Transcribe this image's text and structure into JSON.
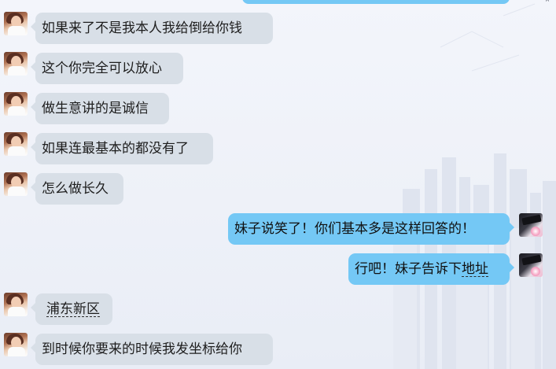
{
  "window": {
    "close_glyph": "˄"
  },
  "messages": [
    {
      "side": "left",
      "text": "如果来了不是我本人我给倒给你钱"
    },
    {
      "side": "left",
      "text": "这个你完全可以放心"
    },
    {
      "side": "left",
      "text": "做生意讲的是诚信"
    },
    {
      "side": "left",
      "text": "如果连最基本的都没有了"
    },
    {
      "side": "left",
      "text": "怎么做长久"
    },
    {
      "side": "right",
      "text": "妹子说笑了！你们基本多是这样回答的！"
    },
    {
      "side": "right",
      "text_before": "行吧！妹子告诉下",
      "link": "地址"
    },
    {
      "side": "left",
      "link": "浦东新区"
    },
    {
      "side": "left",
      "text": "到时候你要来的时候我发坐标给你"
    }
  ],
  "icons": {
    "close": "close-icon",
    "contact_avatar": "contact-avatar-icon",
    "self_avatar": "self-avatar-icon"
  },
  "colors": {
    "incoming_bubble": "#d8dfe7",
    "outgoing_bubble": "#74c8f5",
    "background": "#eef1f8"
  }
}
